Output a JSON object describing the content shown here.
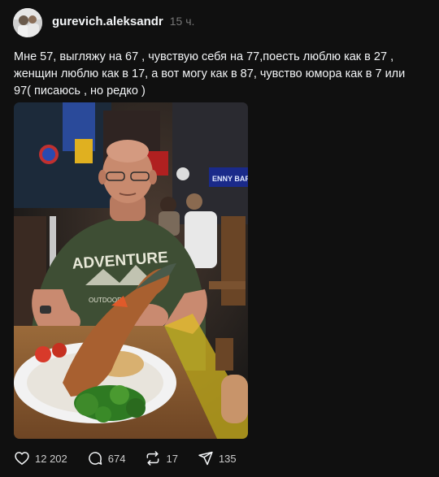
{
  "post": {
    "username": "gurevich.aleksandr",
    "time": "15 ч.",
    "caption": "Мне 57, выгляжу на 67 , чувствую себя на 77,поесть люблю как в 27 , женщин люблю как в 17, а вот могу как в 87, чувство юмора как в 7 или 97( писаюсь , но редко )",
    "photo": {
      "shirt_text": "ADVENTURE",
      "shirt_subtext": "OUTDOOR GEAR",
      "sign_text": "ENNY BAR"
    }
  },
  "actions": {
    "like": {
      "icon": "heart-icon",
      "count": "12 202"
    },
    "comment": {
      "icon": "comment-icon",
      "count": "674"
    },
    "repost": {
      "icon": "repost-icon",
      "count": "17"
    },
    "share": {
      "icon": "share-icon",
      "count": "135"
    }
  },
  "colors": {
    "background": "#101010",
    "text": "#f3f5f7",
    "muted": "#777777"
  }
}
